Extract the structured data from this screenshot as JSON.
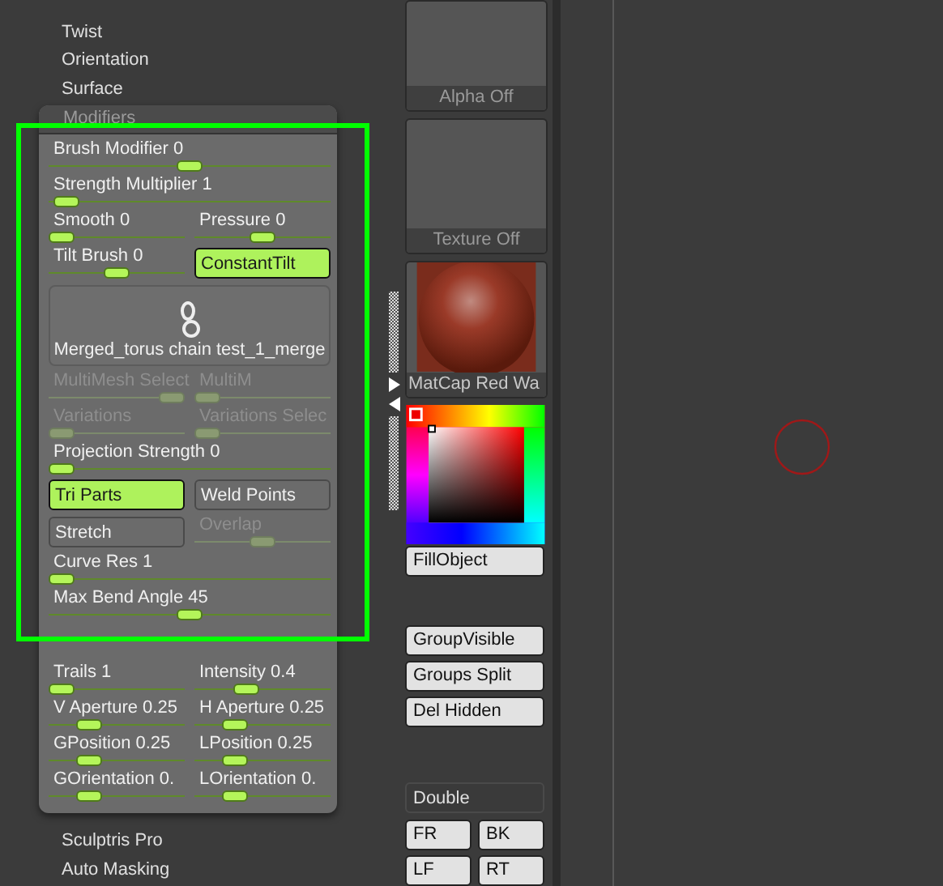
{
  "menu_top": [
    "Twist",
    "Orientation",
    "Surface"
  ],
  "panel": {
    "title": "Modifiers",
    "highlighted": true,
    "sections": [
      [
        {
          "items": [
            {
              "kind": "slider",
              "label": "Brush Modifier 0",
              "level": 0.5,
              "disabled": false
            }
          ]
        },
        {
          "items": [
            {
              "kind": "slider",
              "label": "Strength Multiplier 1",
              "level": 0.02,
              "disabled": false
            }
          ]
        },
        {
          "items": [
            {
              "kind": "slider",
              "label": "Smooth 0",
              "level": 0,
              "disabled": false
            },
            {
              "kind": "slider",
              "label": "Pressure 0",
              "level": 0.5,
              "disabled": false
            }
          ]
        },
        {
          "items": [
            {
              "kind": "slider",
              "label": "Tilt Brush 0",
              "level": 0.5,
              "disabled": false
            },
            {
              "kind": "button",
              "label": "ConstantTilt",
              "on": true
            }
          ]
        },
        {
          "items": [
            {
              "kind": "mesh",
              "label": "Merged_torus chain test_1_merge"
            }
          ]
        },
        {
          "items": [
            {
              "kind": "slider",
              "label": "MultiMesh Select",
              "level": 1,
              "disabled": true
            },
            {
              "kind": "slider",
              "label": "MultiM",
              "level": 0,
              "disabled": true
            }
          ]
        },
        {
          "items": [
            {
              "kind": "slider",
              "label": "Variations",
              "level": 0,
              "disabled": true
            },
            {
              "kind": "slider",
              "label": "Variations Selec",
              "level": 0,
              "disabled": true
            }
          ]
        },
        {
          "items": [
            {
              "kind": "slider",
              "label": "Projection Strength 0",
              "level": 0,
              "disabled": false
            }
          ]
        },
        {
          "items": [
            {
              "kind": "button",
              "label": "Tri Parts",
              "on": true
            },
            {
              "kind": "button",
              "label": "Weld Points",
              "on": false
            }
          ]
        },
        {
          "items": [
            {
              "kind": "button",
              "label": "Stretch",
              "on": false
            },
            {
              "kind": "slider",
              "label": "Overlap",
              "level": 0.5,
              "disabled": true
            }
          ]
        },
        {
          "items": [
            {
              "kind": "slider",
              "label": "Curve Res 1",
              "level": 0,
              "disabled": false
            }
          ]
        },
        {
          "items": [
            {
              "kind": "slider",
              "label": "Max Bend Angle 45",
              "level": 0.5,
              "disabled": false
            }
          ]
        }
      ],
      [
        {
          "items": [
            {
              "kind": "slider",
              "label": "Trails 1",
              "level": 0,
              "disabled": false
            },
            {
              "kind": "slider",
              "label": "Intensity 0.4",
              "level": 0.35,
              "disabled": false
            }
          ]
        },
        {
          "items": [
            {
              "kind": "slider",
              "label": "V Aperture 0.25",
              "level": 0.25,
              "disabled": false
            },
            {
              "kind": "slider",
              "label": "H Aperture 0.25",
              "level": 0.25,
              "disabled": false
            }
          ]
        },
        {
          "items": [
            {
              "kind": "slider",
              "label": "GPosition 0.25",
              "level": 0.25,
              "disabled": false
            },
            {
              "kind": "slider",
              "label": "LPosition 0.25",
              "level": 0.25,
              "disabled": false
            }
          ]
        },
        {
          "items": [
            {
              "kind": "slider",
              "label": "GOrientation 0.",
              "level": 0.25,
              "disabled": false
            },
            {
              "kind": "slider",
              "label": "LOrientation 0.",
              "level": 0.25,
              "disabled": false
            }
          ]
        }
      ]
    ]
  },
  "menu_bottom": [
    "Sculptris Pro",
    "Auto Masking"
  ],
  "palette": {
    "alpha": "Alpha Off",
    "texture": "Texture Off",
    "material": "MatCap Red Wa",
    "button_groups": [
      [
        "FillObject"
      ],
      [
        "GroupVisible",
        "Groups Split",
        "Del Hidden"
      ]
    ],
    "double": "Double",
    "views": [
      "FR",
      "BK",
      "LF",
      "RT"
    ]
  }
}
